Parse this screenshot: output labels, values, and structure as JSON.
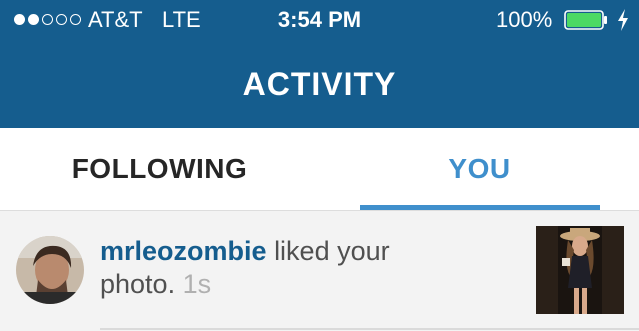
{
  "status_bar": {
    "signal_bars_filled": 2,
    "signal_bars_total": 5,
    "carrier": "AT&T",
    "network": "LTE",
    "time": "3:54 PM",
    "battery_percent": "100%",
    "battery_level": 1.0,
    "battery_color": "#4cd964",
    "charging": true
  },
  "header": {
    "title": "ACTIVITY",
    "background": "#155d8e"
  },
  "tabs": [
    {
      "label": "FOLLOWING",
      "selected": false
    },
    {
      "label": "YOU",
      "selected": true
    }
  ],
  "colors": {
    "accent": "#3f8fcc",
    "username": "#155d8e",
    "timestamp": "#b0b0b0"
  },
  "activity": [
    {
      "username": "mrleozombie",
      "action": "liked your photo.",
      "time_ago": "1s",
      "avatar_icon": "profile-photo",
      "thumbnail_icon": "photo-thumbnail"
    }
  ]
}
